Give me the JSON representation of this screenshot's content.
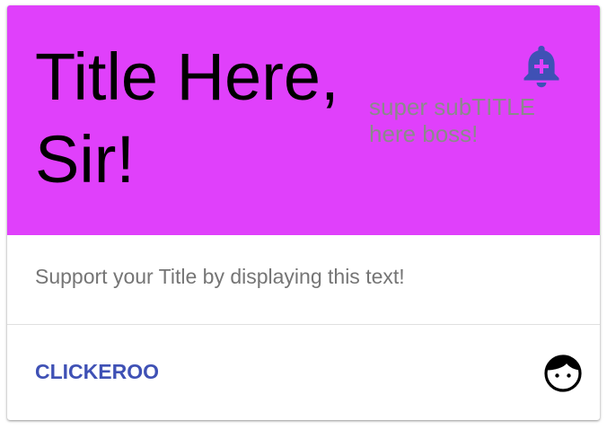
{
  "card": {
    "title": "Title Here, Sir!",
    "subtitle": "super subTITLE here boss!",
    "supporting_text": "Support your Title by displaying this text!",
    "action_label": "CLICKEROO",
    "header_icon": "notification-add-icon",
    "action_icon": "face-icon"
  },
  "colors": {
    "header_background": "#e040fb",
    "bell_icon": "#3f51b5",
    "action_text": "#3f51b5",
    "subtitle_text": "#8a8a8a",
    "supporting_text": "#757575"
  }
}
